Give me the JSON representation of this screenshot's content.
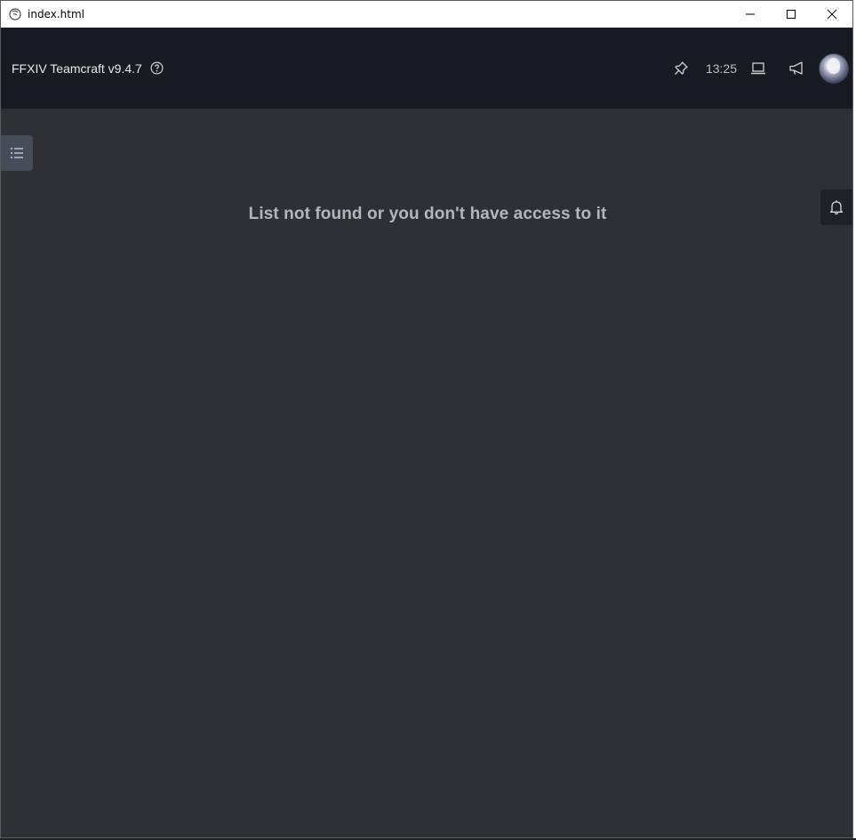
{
  "window": {
    "title": "index.html",
    "controls": {
      "minimize": "minimize-icon",
      "maximize": "maximize-icon",
      "close": "close-icon"
    }
  },
  "header": {
    "app_name": "FFXIV Teamcraft v9.4.7",
    "help_icon": "question-circle-icon",
    "pin_icon": "pushpin-icon",
    "clock": "13:25",
    "desktop_icon": "laptop-icon",
    "announcement_icon": "megaphone-icon",
    "avatar": "user-avatar"
  },
  "content": {
    "sider_toggle_icon": "unordered-list-icon",
    "message": "List not found or you don't have access to it",
    "notification_icon": "bell-icon"
  },
  "colors": {
    "header_bg": "#181b21",
    "content_bg": "#2e3036",
    "message_text": "#b4b6ba"
  }
}
